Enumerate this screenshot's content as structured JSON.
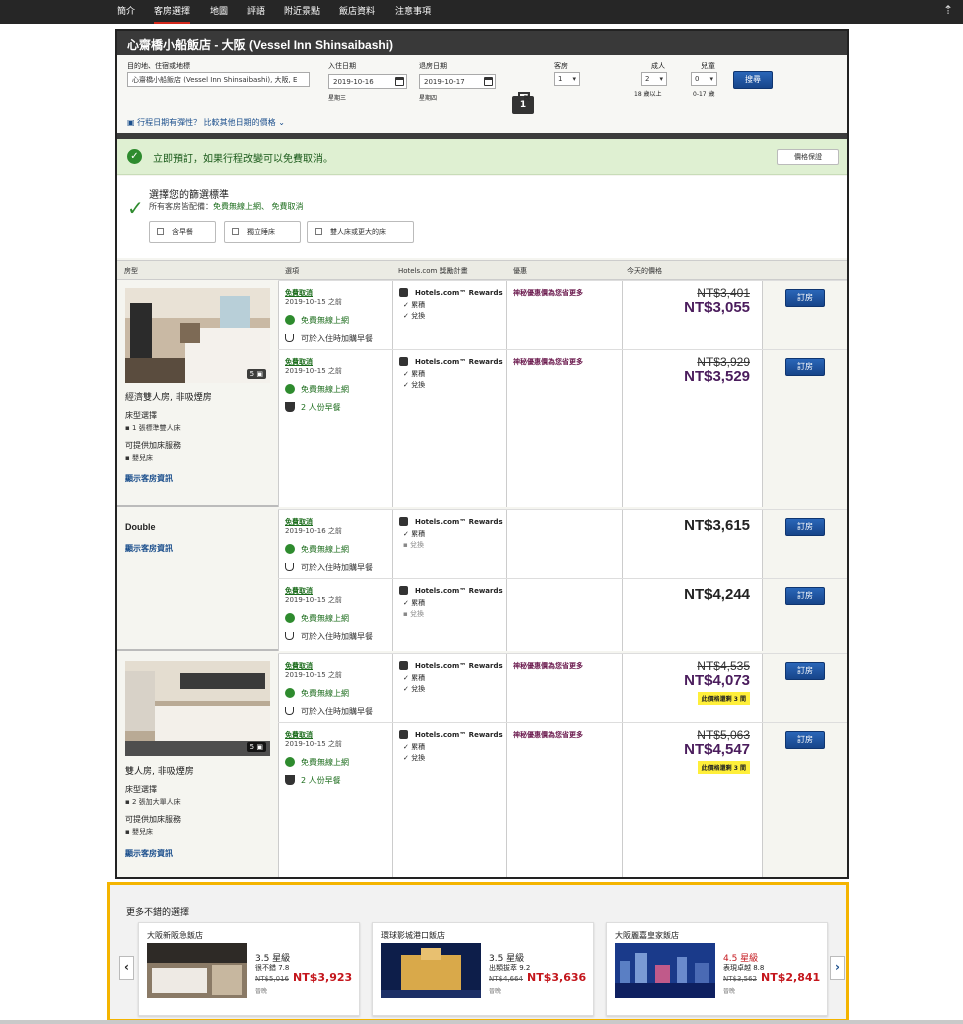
{
  "nav": {
    "items": [
      "簡介",
      "客房選擇",
      "地圖",
      "評語",
      "附近景點",
      "飯店資料",
      "注意事項"
    ],
    "active": "客房選擇"
  },
  "header": {
    "title": "心齋橋小船飯店 - 大阪 (Vessel Inn Shinsaibashi)"
  },
  "search": {
    "destination_label": "目的地、住宿或地標",
    "destination_value": "心齋橋小船飯店 (Vessel Inn Shinsaibashi), 大阪, E",
    "checkin_label": "入住日期",
    "checkin_value": "2019-10-16",
    "checkin_day": "星期三",
    "checkout_label": "退房日期",
    "checkout_value": "2019-10-17",
    "checkout_day": "星期四",
    "nights": "1",
    "nights_label": "晚",
    "rooms_label": "客房",
    "rooms_value": "1",
    "adults_label": "成人",
    "adults_value": "2",
    "adults_note": "18 歲以上",
    "children_label": "兒童",
    "children_value": "0",
    "children_note": "0-17 歲",
    "search_button": "搜尋",
    "flex_link": "行程日期有彈性？ 比較其他日期的價格"
  },
  "banner": {
    "text": "立即預訂，如果行程改變可以免費取消。",
    "button": "價格保證"
  },
  "filters": {
    "title": "選擇您的篩選標準",
    "sub_prefix": "所有客房皆配備：",
    "sub_values": "免費無線上網、 免費取消",
    "options": [
      "含早餐",
      "獨立睡床",
      "雙人床或更大的床"
    ]
  },
  "table": {
    "headers": [
      "房型",
      "選項",
      "Hotels.com 獎勵計畫",
      "優惠",
      "今天的價格"
    ]
  },
  "common": {
    "cancel": "免費取消",
    "wifi": "免費無線上網",
    "breakfast_addon": "可於入住時加購早餐",
    "breakfast_2": "2 人份早餐",
    "rewards": "Hotels.com™ Rewards",
    "collect": "累積",
    "redeem": "兌換",
    "secret_deal": "神秘優惠價為您省更多",
    "book": "訂房",
    "bed_section": "床型選擇",
    "extra_section": "可提供加床服務",
    "crib": "嬰兒床",
    "room_info_link": "顯示客房資訊",
    "left3": "此價格還剩 3 間",
    "before": "之前"
  },
  "rooms": [
    {
      "name": "經濟雙人房, 非吸煙房",
      "photo_count": "5",
      "bed": "1 張標準雙人床",
      "options": [
        {
          "date": "2019-10-15",
          "old": "NT$3,401",
          "price": "NT$3,055"
        },
        {
          "date": "2019-10-15",
          "old": "NT$3,929",
          "price": "NT$3,529"
        }
      ]
    },
    {
      "name": "Double",
      "options": [
        {
          "date": "2019-10-16",
          "price": "NT$3,615"
        },
        {
          "date": "2019-10-15",
          "price": "NT$4,244"
        }
      ]
    },
    {
      "name": "雙人房, 非吸煙房",
      "photo_count": "5",
      "bed": "2 張加大單人床",
      "options": [
        {
          "date": "2019-10-15",
          "old": "NT$4,535",
          "price": "NT$4,073"
        },
        {
          "date": "2019-10-15",
          "old": "NT$5,063",
          "price": "NT$4,547"
        }
      ]
    }
  ],
  "more": {
    "title": "更多不錯的選擇",
    "hotels": [
      {
        "name": "大阪新阪急飯店",
        "stars": "3.5 星級",
        "rating": "很不錯 7.8",
        "old": "NT$5,016",
        "price": "NT$3,923",
        "note": "晉晚"
      },
      {
        "name": "環球影城港口飯店",
        "stars": "3.5 星級",
        "rating": "出類拔萃 9.2",
        "old": "NT$4,664",
        "price": "NT$3,636",
        "note": "晉晚"
      },
      {
        "name": "大阪麗嘉皇家飯店",
        "stars": "4.5 星級",
        "rating": "表現卓越 8.8",
        "old": "NT$3,562",
        "price": "NT$2,841",
        "note": "晉晚"
      }
    ]
  }
}
